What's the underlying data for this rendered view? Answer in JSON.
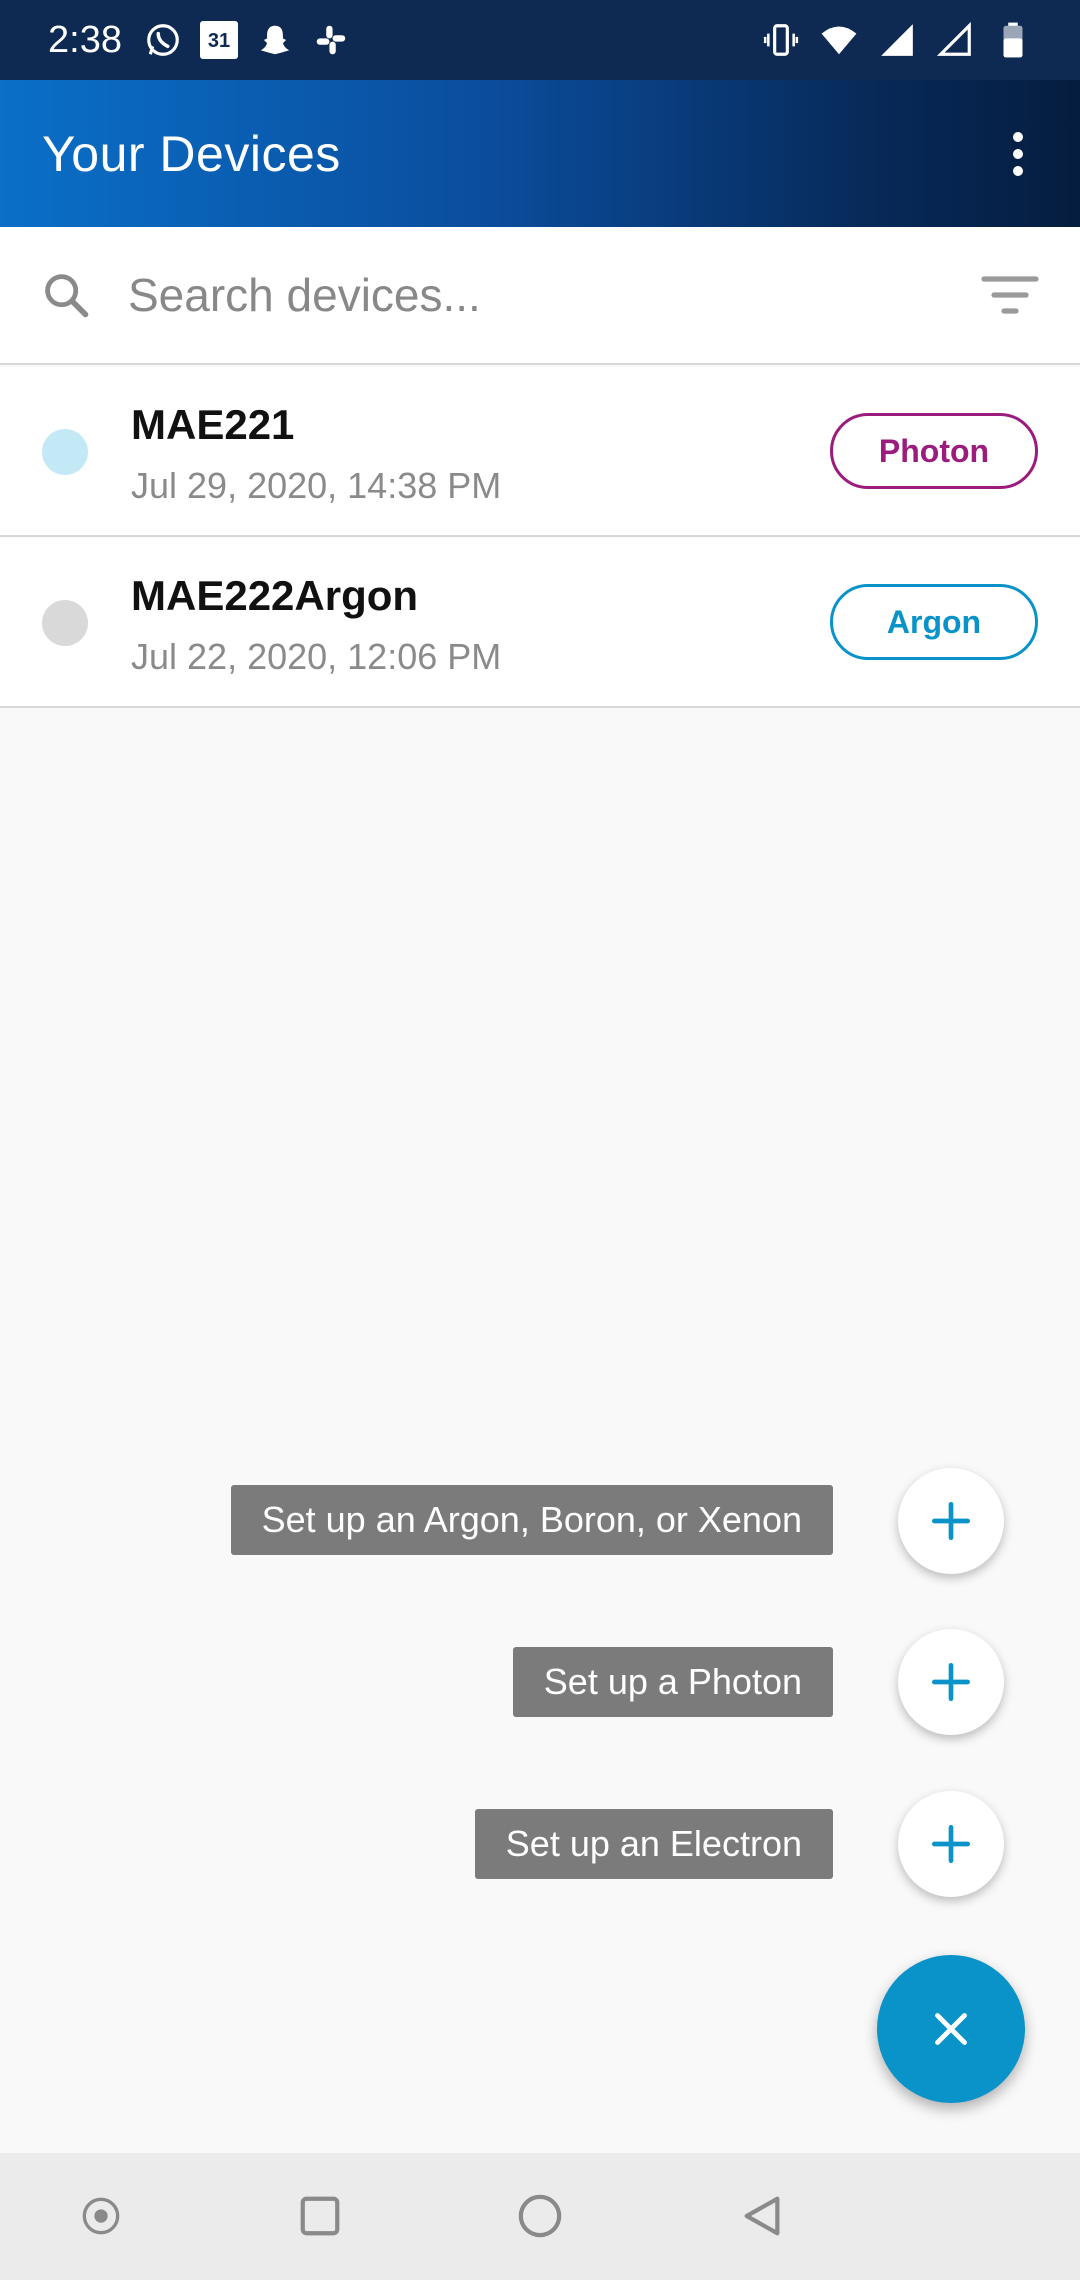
{
  "status_bar": {
    "time": "2:38",
    "left_icons": [
      "whatsapp-icon",
      "calendar-icon",
      "snapchat-icon",
      "slack-icon"
    ],
    "calendar_day": "31",
    "right_icons": [
      "vibrate-icon",
      "wifi-icon",
      "signal-icon",
      "signal-empty-icon",
      "battery-icon"
    ]
  },
  "app_bar": {
    "title": "Your Devices",
    "menu_icon": "more-vert-icon"
  },
  "search": {
    "placeholder": "Search devices...",
    "value": "",
    "search_icon": "search-icon",
    "filter_icon": "filter-icon"
  },
  "devices": [
    {
      "name": "MAE221",
      "last_seen": "Jul 29, 2020, 14:38 PM",
      "type": "Photon",
      "type_color": "#9b1c7d",
      "status_color": "#c3e9f7"
    },
    {
      "name": "MAE222Argon",
      "last_seen": "Jul 22, 2020, 12:06 PM",
      "type": "Argon",
      "type_color": "#0a93c8",
      "status_color": "#d9d9d9"
    }
  ],
  "setup_menu": [
    {
      "label": "Set up an Argon, Boron, or Xenon",
      "icon": "plus-icon"
    },
    {
      "label": "Set up a Photon",
      "icon": "plus-icon"
    },
    {
      "label": "Set up an Electron",
      "icon": "plus-icon"
    }
  ],
  "main_fab": {
    "icon": "close-icon",
    "color": "#0a93c8"
  },
  "colors": {
    "accent": "#0a93c8",
    "app_bar_start": "#0a6fc7",
    "app_bar_end": "#051d3f"
  },
  "nav_bar": [
    "dot-icon",
    "recents-icon",
    "home-icon",
    "back-icon"
  ]
}
